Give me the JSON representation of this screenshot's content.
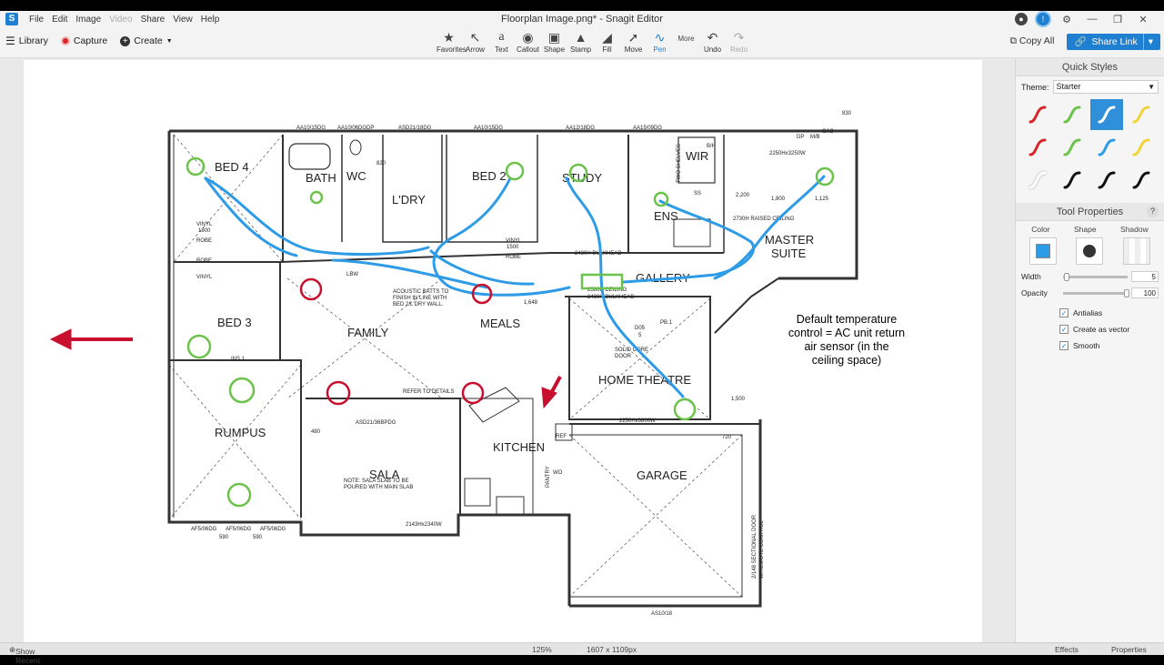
{
  "titlebar": {
    "menu": [
      "File",
      "Edit",
      "Image",
      "Video",
      "Share",
      "View",
      "Help"
    ],
    "menu_disabled": [
      "Video"
    ],
    "document_title": "Floorplan Image.png* - Snagit Editor",
    "window_controls": [
      "minimize-icon",
      "restore-icon",
      "close-icon"
    ]
  },
  "toolbar": {
    "left": {
      "library_label": "Library",
      "capture_label": "Capture",
      "create_label": "Create"
    },
    "tools": [
      {
        "label": "Favorites",
        "icon": "star-icon"
      },
      {
        "label": "Arrow",
        "icon": "arrow-icon"
      },
      {
        "label": "Text",
        "icon": "text-icon"
      },
      {
        "label": "Callout",
        "icon": "callout-icon"
      },
      {
        "label": "Shape",
        "icon": "shape-icon"
      },
      {
        "label": "Stamp",
        "icon": "stamp-icon"
      },
      {
        "label": "Fill",
        "icon": "fill-icon"
      },
      {
        "label": "Move",
        "icon": "move-icon"
      },
      {
        "label": "Pen",
        "icon": "pen-icon",
        "active": true
      },
      {
        "label": "More",
        "icon": "more-icon"
      },
      {
        "label": "Undo",
        "icon": "undo-icon"
      },
      {
        "label": "Redo",
        "icon": "redo-icon",
        "disabled": true
      }
    ],
    "copy_all_label": "Copy All",
    "share_link_label": "Share Link"
  },
  "canvas": {
    "annotation_note": "Default temperature control = AC unit return air sensor (in the ceiling space)",
    "room_labels": {
      "bed4": "BED 4",
      "bath": "BATH",
      "wc": "WC",
      "ldry": "L'DRY",
      "bed2": "BED 2",
      "study": "STUDY",
      "wir": "WIR",
      "ens": "ENS",
      "master": "MASTER",
      "suite": "SUITE",
      "gallery": "GALLERY",
      "bed3": "BED 3",
      "family": "FAMILY",
      "meals": "MEALS",
      "home_theatre": "HOME THEATRE",
      "rumpus": "RUMPUS",
      "kitchen": "KITCHEN",
      "sala": "SALA",
      "garage": "GARAGE"
    },
    "small_labels": {
      "robe1": "ROBE",
      "robe2": "ROBE",
      "robe3": "ROBE",
      "vinyl1": "VINYL",
      "vinyl1b": "1800",
      "vinyl2": "VINYL",
      "vinyl2b": "1500",
      "vinyl3": "VINYL",
      "ins1": "INS.1",
      "lbw": "LBW",
      "pb1": "PB.1",
      "d05": "D05",
      "d05b": "5",
      "acoustic1": "ACOUSTIC BATTS TO",
      "acoustic2": "FINISH IN LINE WITH",
      "acoustic3": "BED 2/L'DRY WALL.",
      "refer": "REFER TO DETAILS",
      "sala_note1": "NOTE: SALA SLAB TO BE",
      "sala_note2": "POURED WITH MAIN SLAB",
      "ceiling1": "2580H CEILING",
      "ceiling2": "2430H BULKHEAD",
      "bulkhead": "2430H BULKHEAD",
      "raised": "2730H RAISED CEILING",
      "solid": "SOLID CORE",
      "solidb": "DOOR",
      "dim1": "2250Hx3250W",
      "dim2": "2250Hx3800W",
      "dim3": "2143Hx2340W",
      "dim4": "1,800",
      "dim5": "1,125",
      "dim6": "1,500",
      "dim7": "1,648",
      "dim8": "830",
      "dim9": "590",
      "dim10": "590",
      "dim11": "480",
      "dim12": "720",
      "dim13": "820",
      "dim14": "2,200",
      "win1": "AA10/15DG",
      "win2": "AA10/06DGDP",
      "win3": "ASD21/18DG",
      "win4": "AA12/18DG",
      "win5": "AA15/09DG",
      "win6": "AF5/06DG",
      "win7": "AS10/18",
      "win8": "ASD21/36BPDG",
      "pantry": "PANTRY",
      "wo": "WO",
      "ref": "REF",
      "gas": "GAS",
      "dp": "DP",
      "mb": "M/B",
      "ss": "SS",
      "two_shelves": "TWO SHELVES",
      "bh": "B/H",
      "garage_door": "2/148 SECTIONAL DOOR",
      "garage_door2": "W/REMOTE CONTROL"
    }
  },
  "quick_styles": {
    "title": "Quick Styles",
    "theme_label": "Theme:",
    "theme_value": "Starter",
    "styles": [
      {
        "color": "#d9252a"
      },
      {
        "color": "#6cc24a"
      },
      {
        "color": "#2e9be6",
        "selected": true
      },
      {
        "color": "#f0d43a"
      },
      {
        "color": "#d9252a"
      },
      {
        "color": "#6cc24a"
      },
      {
        "color": "#2e9be6"
      },
      {
        "color": "#f0d43a"
      },
      {
        "color": "#ffffff"
      },
      {
        "color": "#111111"
      },
      {
        "color": "#111111"
      },
      {
        "color": "#111111"
      }
    ]
  },
  "tool_properties": {
    "title": "Tool Properties",
    "help": "?",
    "color_label": "Color",
    "shape_label": "Shape",
    "shadow_label": "Shadow",
    "pen_color": "#2e9be6",
    "width_label": "Width",
    "width_value": "5",
    "opacity_label": "Opacity",
    "opacity_value": "100",
    "checks": [
      {
        "label": "Antialias",
        "checked": true
      },
      {
        "label": "Create as vector",
        "checked": true
      },
      {
        "label": "Smooth",
        "checked": true
      }
    ]
  },
  "statusbar": {
    "show_recent": "Show Recent",
    "zoom": "125%",
    "dimensions": "1607 x 1109px",
    "effects": "Effects",
    "properties": "Properties"
  }
}
